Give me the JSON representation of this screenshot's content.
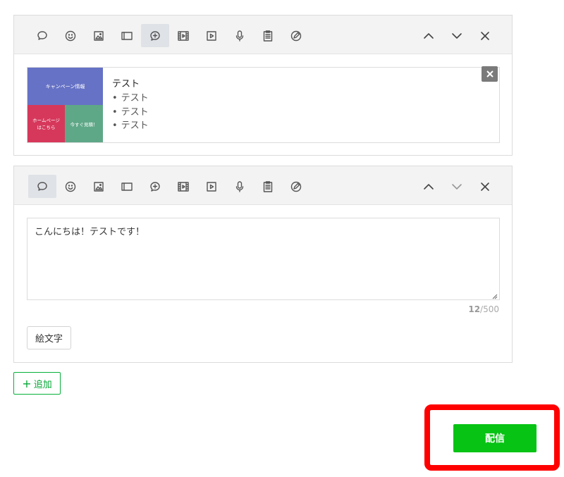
{
  "message1": {
    "card": {
      "image_top": "キャンペーン情報",
      "image_bottom_left": "ホームページ\nはこちら",
      "image_bottom_right": "今すぐ見積！",
      "title": "テスト",
      "items": [
        "テスト",
        "テスト",
        "テスト"
      ]
    }
  },
  "message2": {
    "text": "こんにちは！テストです！",
    "char_count": "12",
    "char_max": "/500",
    "emoji_label": "絵文字"
  },
  "add_label": "追加",
  "send_label": "配信",
  "colors": {
    "accent_green": "#06c314",
    "highlight_red": "#ff0000",
    "card_blue": "#6672c5",
    "card_red": "#d6385b",
    "card_green": "#5fa887"
  },
  "toolbar_icons": [
    "text-bubble-icon",
    "emoji-icon",
    "image-icon",
    "card-icon",
    "rich-message-icon",
    "video-icon",
    "play-icon",
    "mic-icon",
    "clipboard-icon",
    "coupon-icon"
  ]
}
